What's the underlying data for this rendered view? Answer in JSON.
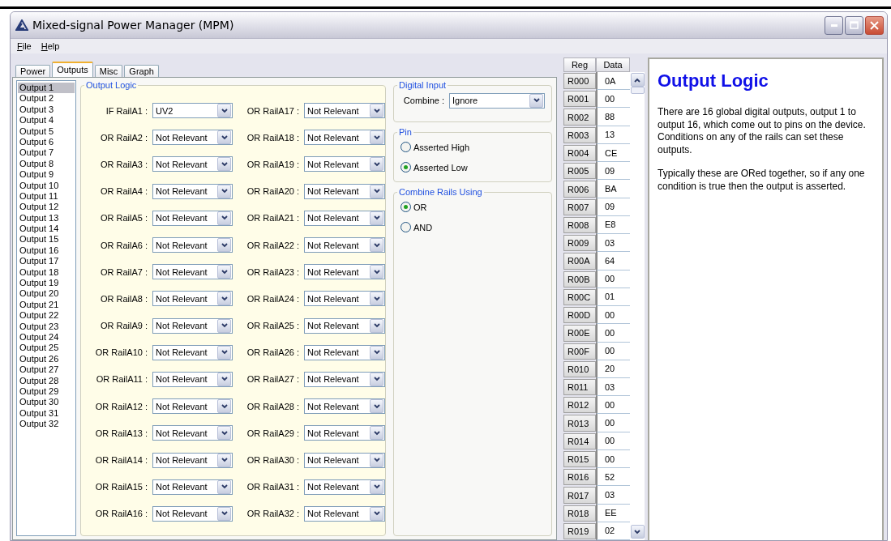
{
  "window": {
    "title": "Mixed-signal Power Manager (MPM)"
  },
  "menu": [
    {
      "label": "File"
    },
    {
      "label": "Help"
    }
  ],
  "tabs": [
    {
      "label": "Power",
      "selected": false
    },
    {
      "label": "Outputs",
      "selected": true
    },
    {
      "label": "Misc",
      "selected": false
    },
    {
      "label": "Graph",
      "selected": false
    }
  ],
  "outputs": [
    {
      "label": "Output 1",
      "selected": true
    },
    {
      "label": "Output 2",
      "selected": false
    },
    {
      "label": "Output 3",
      "selected": false
    },
    {
      "label": "Output 4",
      "selected": false
    },
    {
      "label": "Output 5",
      "selected": false
    },
    {
      "label": "Output 6",
      "selected": false
    },
    {
      "label": "Output 7",
      "selected": false
    },
    {
      "label": "Output 8",
      "selected": false
    },
    {
      "label": "Output 9",
      "selected": false
    },
    {
      "label": "Output 10",
      "selected": false
    },
    {
      "label": "Output 11",
      "selected": false
    },
    {
      "label": "Output 12",
      "selected": false
    },
    {
      "label": "Output 13",
      "selected": false
    },
    {
      "label": "Output 14",
      "selected": false
    },
    {
      "label": "Output 15",
      "selected": false
    },
    {
      "label": "Output 16",
      "selected": false
    },
    {
      "label": "Output 17",
      "selected": false
    },
    {
      "label": "Output 18",
      "selected": false
    },
    {
      "label": "Output 19",
      "selected": false
    },
    {
      "label": "Output 20",
      "selected": false
    },
    {
      "label": "Output 21",
      "selected": false
    },
    {
      "label": "Output 22",
      "selected": false
    },
    {
      "label": "Output 23",
      "selected": false
    },
    {
      "label": "Output 24",
      "selected": false
    },
    {
      "label": "Output 25",
      "selected": false
    },
    {
      "label": "Output 26",
      "selected": false
    },
    {
      "label": "Output 27",
      "selected": false
    },
    {
      "label": "Output 28",
      "selected": false
    },
    {
      "label": "Output 29",
      "selected": false
    },
    {
      "label": "Output 30",
      "selected": false
    },
    {
      "label": "Output 31",
      "selected": false
    },
    {
      "label": "Output 32",
      "selected": false
    }
  ],
  "output_logic": {
    "title": "Output Logic",
    "rows": [
      {
        "left": {
          "label": "IF RailA1 :",
          "value": "UV2"
        },
        "right": {
          "label": "OR RailA17 :",
          "value": "Not Relevant"
        }
      },
      {
        "left": {
          "label": "OR RailA2 :",
          "value": "Not Relevant"
        },
        "right": {
          "label": "OR RailA18 :",
          "value": "Not Relevant"
        }
      },
      {
        "left": {
          "label": "OR RailA3 :",
          "value": "Not Relevant"
        },
        "right": {
          "label": "OR RailA19 :",
          "value": "Not Relevant"
        }
      },
      {
        "left": {
          "label": "OR RailA4 :",
          "value": "Not Relevant"
        },
        "right": {
          "label": "OR RailA20 :",
          "value": "Not Relevant"
        }
      },
      {
        "left": {
          "label": "OR RailA5 :",
          "value": "Not Relevant"
        },
        "right": {
          "label": "OR RailA21 :",
          "value": "Not Relevant"
        }
      },
      {
        "left": {
          "label": "OR RailA6 :",
          "value": "Not Relevant"
        },
        "right": {
          "label": "OR RailA22 :",
          "value": "Not Relevant"
        }
      },
      {
        "left": {
          "label": "OR RailA7 :",
          "value": "Not Relevant"
        },
        "right": {
          "label": "OR RailA23 :",
          "value": "Not Relevant"
        }
      },
      {
        "left": {
          "label": "OR RailA8 :",
          "value": "Not Relevant"
        },
        "right": {
          "label": "OR RailA24 :",
          "value": "Not Relevant"
        }
      },
      {
        "left": {
          "label": "OR RailA9 :",
          "value": "Not Relevant"
        },
        "right": {
          "label": "OR RailA25 :",
          "value": "Not Relevant"
        }
      },
      {
        "left": {
          "label": "OR RailA10 :",
          "value": "Not Relevant"
        },
        "right": {
          "label": "OR RailA26 :",
          "value": "Not Relevant"
        }
      },
      {
        "left": {
          "label": "OR RailA11 :",
          "value": "Not Relevant"
        },
        "right": {
          "label": "OR RailA27 :",
          "value": "Not Relevant"
        }
      },
      {
        "left": {
          "label": "OR RailA12 :",
          "value": "Not Relevant"
        },
        "right": {
          "label": "OR RailA28 :",
          "value": "Not Relevant"
        }
      },
      {
        "left": {
          "label": "OR RailA13 :",
          "value": "Not Relevant"
        },
        "right": {
          "label": "OR RailA29 :",
          "value": "Not Relevant"
        }
      },
      {
        "left": {
          "label": "OR RailA14 :",
          "value": "Not Relevant"
        },
        "right": {
          "label": "OR RailA30 :",
          "value": "Not Relevant"
        }
      },
      {
        "left": {
          "label": "OR RailA15 :",
          "value": "Not Relevant"
        },
        "right": {
          "label": "OR RailA31 :",
          "value": "Not Relevant"
        }
      },
      {
        "left": {
          "label": "OR RailA16 :",
          "value": "Not Relevant"
        },
        "right": {
          "label": "OR RailA32 :",
          "value": "Not Relevant"
        }
      }
    ]
  },
  "digital_input": {
    "title": "Digital Input",
    "label": "Combine :",
    "value": "Ignore"
  },
  "pin": {
    "title": "Pin",
    "options": [
      {
        "label": "Asserted High",
        "selected": false
      },
      {
        "label": "Asserted Low",
        "selected": true
      }
    ]
  },
  "combine_rails": {
    "title": "Combine Rails Using",
    "options": [
      {
        "label": "OR",
        "selected": true
      },
      {
        "label": "AND",
        "selected": false
      }
    ]
  },
  "registers": {
    "columns": [
      "Reg",
      "Data"
    ],
    "rows": [
      {
        "reg": "R000",
        "data": "0A"
      },
      {
        "reg": "R001",
        "data": "00"
      },
      {
        "reg": "R002",
        "data": "88"
      },
      {
        "reg": "R003",
        "data": "13"
      },
      {
        "reg": "R004",
        "data": "CE"
      },
      {
        "reg": "R005",
        "data": "09"
      },
      {
        "reg": "R006",
        "data": "BA"
      },
      {
        "reg": "R007",
        "data": "09"
      },
      {
        "reg": "R008",
        "data": "E8"
      },
      {
        "reg": "R009",
        "data": "03"
      },
      {
        "reg": "R00A",
        "data": "64"
      },
      {
        "reg": "R00B",
        "data": "00"
      },
      {
        "reg": "R00C",
        "data": "01"
      },
      {
        "reg": "R00D",
        "data": "00"
      },
      {
        "reg": "R00E",
        "data": "00"
      },
      {
        "reg": "R00F",
        "data": "00"
      },
      {
        "reg": "R010",
        "data": "20"
      },
      {
        "reg": "R011",
        "data": "03"
      },
      {
        "reg": "R012",
        "data": "00"
      },
      {
        "reg": "R013",
        "data": "00"
      },
      {
        "reg": "R014",
        "data": "00"
      },
      {
        "reg": "R015",
        "data": "00"
      },
      {
        "reg": "R016",
        "data": "52"
      },
      {
        "reg": "R017",
        "data": "03"
      },
      {
        "reg": "R018",
        "data": "EE"
      },
      {
        "reg": "R019",
        "data": "02"
      }
    ]
  },
  "help": {
    "title": "Output Logic",
    "paragraphs": [
      "There are 16 global digital outputs, output 1 to output 16, which come out to pins on the device. Conditions on any of the rails can set these outputs.",
      "Typically these are ORed together, so if any one condition is true then the output is asserted."
    ]
  }
}
